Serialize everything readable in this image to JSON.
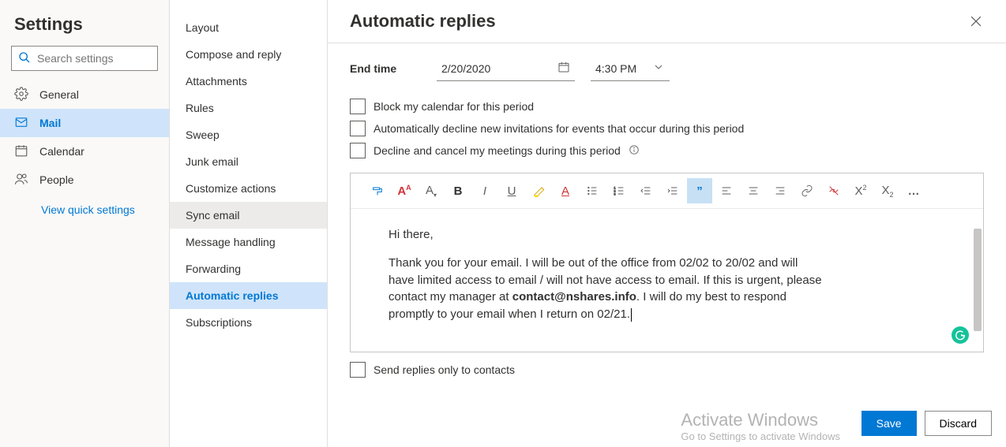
{
  "settings_title": "Settings",
  "search_placeholder": "Search settings",
  "left_nav": {
    "general": "General",
    "mail": "Mail",
    "calendar": "Calendar",
    "people": "People",
    "view_quick": "View quick settings"
  },
  "mid_nav": {
    "layout": "Layout",
    "compose": "Compose and reply",
    "attachments": "Attachments",
    "rules": "Rules",
    "sweep": "Sweep",
    "junk": "Junk email",
    "customize": "Customize actions",
    "sync": "Sync email",
    "handling": "Message handling",
    "forwarding": "Forwarding",
    "auto": "Automatic replies",
    "subs": "Subscriptions"
  },
  "panel": {
    "title": "Automatic replies",
    "end_label": "End time",
    "end_date": "2/20/2020",
    "end_time": "4:30 PM",
    "chk_block": "Block my calendar for this period",
    "chk_decline_new": "Automatically decline new invitations for events that occur during this period",
    "chk_cancel": "Decline and cancel my meetings during this period",
    "send_only": "Send replies only to contacts",
    "body_greeting": "Hi there,",
    "body_p1a": "Thank you for your email. I will be out of the office from 02/02 to 20/02 and will have limited access to email / will not have access to email. If this is urgent, please contact my manager at ",
    "body_email": "contact@nshares.info",
    "body_p1b": ". I will do my best to respond promptly to your email when I return on 02/21.",
    "save": "Save",
    "discard": "Discard"
  },
  "watermark": {
    "l1": "Activate Windows",
    "l2": "Go to Settings to activate Windows"
  }
}
